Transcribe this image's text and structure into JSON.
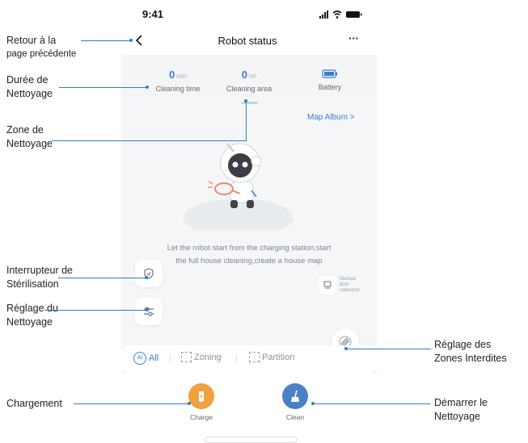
{
  "status_bar": {
    "time": "9:41"
  },
  "nav": {
    "title": "Robot status",
    "more": "···"
  },
  "stats": [
    {
      "value": "0",
      "unit": "min",
      "label": "Cleaning time"
    },
    {
      "value": "0",
      "unit": "m²",
      "label": "Cleaning area"
    },
    {
      "label": "Battery"
    }
  ],
  "map": {
    "album_link": "Map Album >",
    "hint_line1": "Let the robot start from the charging station,start",
    "hint_line2": "the full house cleaning,create a house map",
    "manual_dust": [
      "Manual",
      "dust",
      "collection"
    ]
  },
  "modes": {
    "all": "All",
    "zoning": "Zoning",
    "partition": "Partition"
  },
  "actions": {
    "charge": "Charge",
    "clean": "Clean"
  },
  "annotations": {
    "back": [
      "Retour à la",
      "page précédente"
    ],
    "duration": [
      "Durée de",
      "Nettoyage"
    ],
    "zone": [
      "Zone de",
      "Nettoyage"
    ],
    "sterilization": [
      "Interrupteur de",
      "Stérilisation"
    ],
    "settings": [
      "Réglage du",
      "Nettoyage"
    ],
    "charging": "Chargement",
    "forbidden": [
      "Réglage des",
      "Zones Interdites"
    ],
    "start": [
      "Démarrer le",
      "Nettoyage"
    ]
  },
  "colors": {
    "accent": "#3a7bd5",
    "charge": "#f0a13e",
    "clean": "#4a7fc9",
    "leader": "#2f7ec4"
  }
}
